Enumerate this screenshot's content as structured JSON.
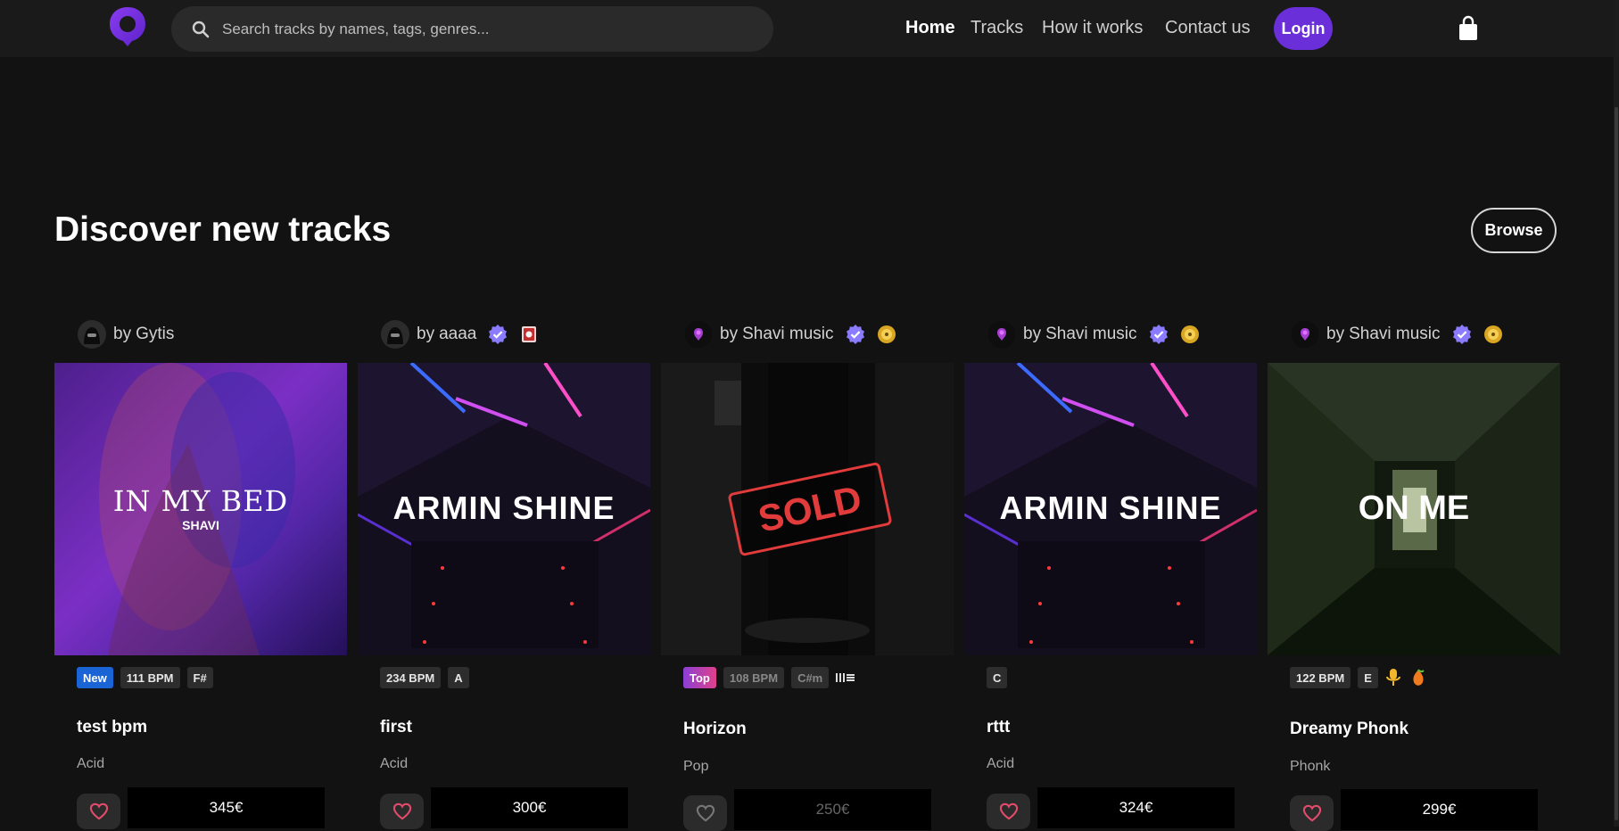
{
  "header": {
    "search_placeholder": "Search tracks by names, tags, genres...",
    "nav": [
      "Home",
      "Tracks",
      "How it works",
      "Contact us"
    ],
    "login_label": "Login"
  },
  "colors": {
    "accent": "#6a2fd8",
    "verified": "#8b7bff",
    "new_badge": "#1b64d6",
    "heart": "#e24b6b"
  },
  "section": {
    "title": "Discover new tracks",
    "browse_label": "Browse"
  },
  "cards": [
    {
      "by": "by",
      "author": "Gytis",
      "verified": false,
      "badge_icon": "",
      "cover_text": "IN MY BED",
      "cover_subtext": "SHAVI",
      "tags": [
        "New",
        "111 BPM",
        "F#"
      ],
      "title": "test bpm",
      "genre": "Acid",
      "price": "345€"
    },
    {
      "by": "by",
      "author": "aaaa",
      "verified": true,
      "badge_icon": "badge-icon",
      "cover_text": "ARMIN SHINE",
      "tags": [
        "234 BPM",
        "A"
      ],
      "title": "first",
      "genre": "Acid",
      "price": "300€"
    },
    {
      "by": "by",
      "author": "Shavi music",
      "verified": true,
      "badge_icon": "gold-disc-icon",
      "cover_text": "SOLD",
      "tags": [
        "Top",
        "108 BPM",
        "C#m"
      ],
      "title": "Horizon",
      "genre": "Pop",
      "price": "250€"
    },
    {
      "by": "by",
      "author": "Shavi music",
      "verified": true,
      "badge_icon": "gold-disc-icon",
      "cover_text": "ARMIN SHINE",
      "tags": [
        "C"
      ],
      "title": "rttt",
      "genre": "Acid",
      "price": "324€"
    },
    {
      "by": "by",
      "author": "Shavi music",
      "verified": true,
      "badge_icon": "gold-disc-icon",
      "cover_text": "ON ME",
      "tags": [
        "122 BPM",
        "E"
      ],
      "title": "Dreamy Phonk",
      "genre": "Phonk",
      "price": "299€"
    }
  ]
}
